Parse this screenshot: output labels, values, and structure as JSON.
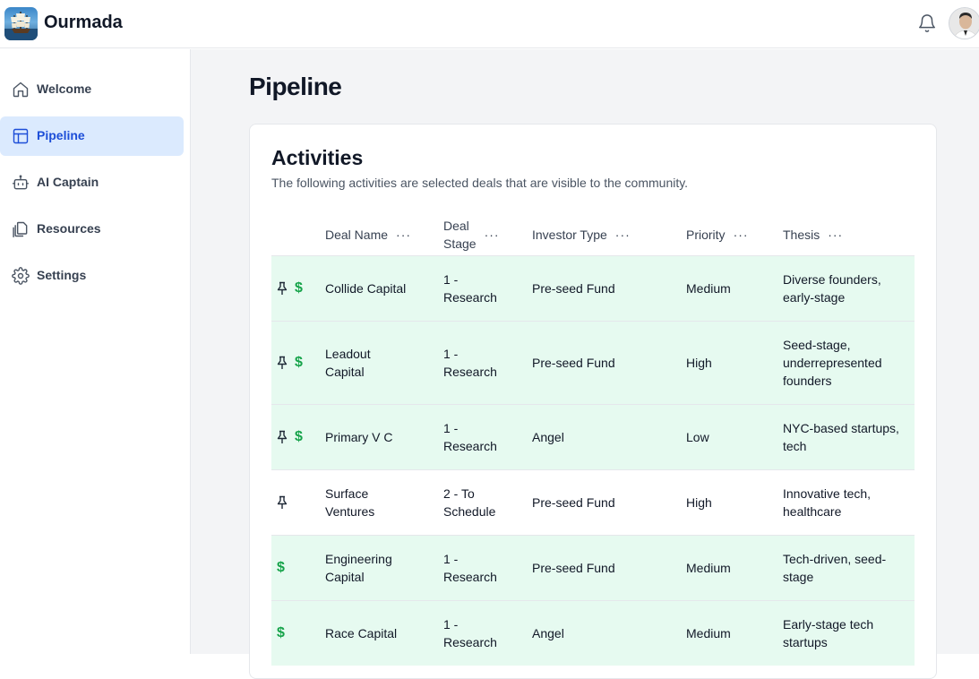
{
  "app": {
    "brand": "Ourmada"
  },
  "header": {
    "notifications_icon": "bell-icon",
    "avatar": "user-avatar"
  },
  "sidebar": {
    "items": [
      {
        "label": "Welcome",
        "icon": "home-icon",
        "active": false
      },
      {
        "label": "Pipeline",
        "icon": "table-icon",
        "active": true
      },
      {
        "label": "AI Captain",
        "icon": "robot-icon",
        "active": false
      },
      {
        "label": "Resources",
        "icon": "documents-icon",
        "active": false
      },
      {
        "label": "Settings",
        "icon": "gear-icon",
        "active": false
      }
    ]
  },
  "main": {
    "title": "Pipeline",
    "card": {
      "title": "Activities",
      "subtitle": "The following activities are selected deals that are visible to the community."
    },
    "table": {
      "columns": [
        {
          "line1": "Deal Name",
          "line2": ""
        },
        {
          "line1": "Deal",
          "line2": "Stage"
        },
        {
          "line1": "Investor Type",
          "line2": ""
        },
        {
          "line1": "Priority",
          "line2": ""
        },
        {
          "line1": "Thesis",
          "line2": ""
        }
      ],
      "menu_glyph": "···",
      "rows": [
        {
          "pinned": true,
          "funded": true,
          "highlight": true,
          "name": "Collide Capital",
          "stage": "1 - Research",
          "investor_type": "Pre-seed Fund",
          "priority": "Medium",
          "thesis": "Diverse founders, early-stage"
        },
        {
          "pinned": true,
          "funded": true,
          "highlight": true,
          "name": "Leadout Capital",
          "stage": "1 - Research",
          "investor_type": "Pre-seed Fund",
          "priority": "High",
          "thesis": "Seed-stage, underrepresented founders"
        },
        {
          "pinned": true,
          "funded": true,
          "highlight": true,
          "name": "Primary V C",
          "stage": "1 - Research",
          "investor_type": "Angel",
          "priority": "Low",
          "thesis": "NYC-based startups, tech"
        },
        {
          "pinned": true,
          "funded": false,
          "highlight": false,
          "name": "Surface Ventures",
          "stage": "2 - To Schedule",
          "investor_type": "Pre-seed Fund",
          "priority": "High",
          "thesis": "Innovative tech, healthcare"
        },
        {
          "pinned": false,
          "funded": true,
          "highlight": true,
          "name": "Engineering Capital",
          "stage": "1 - Research",
          "investor_type": "Pre-seed Fund",
          "priority": "Medium",
          "thesis": "Tech-driven, seed-stage"
        },
        {
          "pinned": false,
          "funded": true,
          "highlight": true,
          "name": "Race Capital",
          "stage": "1 - Research",
          "investor_type": "Angel",
          "priority": "Medium",
          "thesis": "Early-stage tech startups"
        }
      ]
    }
  },
  "colors": {
    "accent": "#1d4ed8",
    "active_bg": "#dbeafe",
    "row_highlight": "#e6faf0",
    "dollar": "#16a34a",
    "main_bg": "#f3f4f6"
  }
}
